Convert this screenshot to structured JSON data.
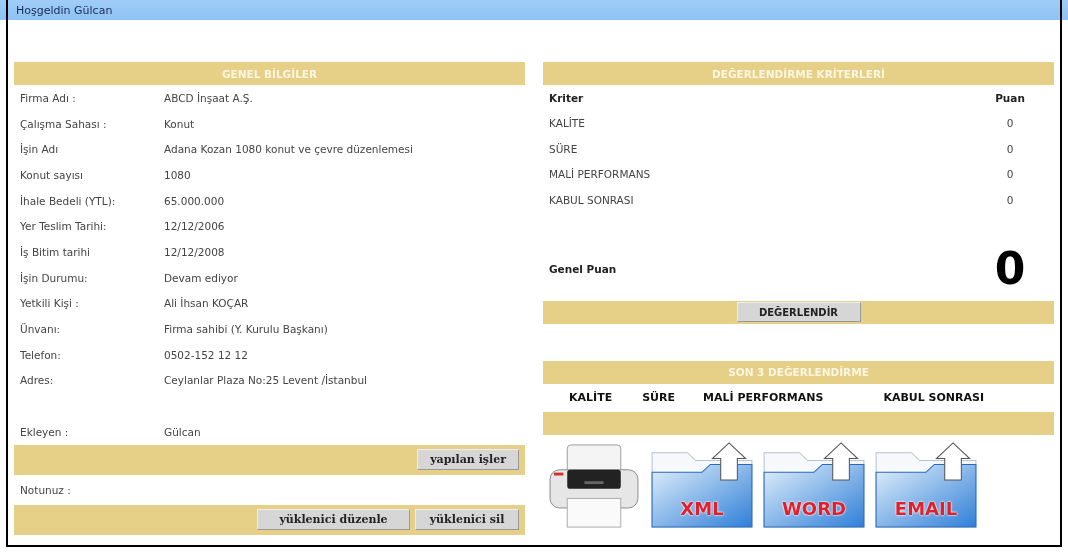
{
  "header": {
    "greeting": "Hoşgeldin Gülcan"
  },
  "general_info": {
    "title": "GENEL BİLGİLER",
    "rows": [
      {
        "label": "Firma Adı :",
        "value": "ABCD İnşaat A.Ş."
      },
      {
        "label": "Çalışma Sahası :",
        "value": "Konut"
      },
      {
        "label": "İşin Adı",
        "value": "Adana Kozan 1080 konut ve çevre düzenlemesi"
      },
      {
        "label": "Konut sayısı",
        "value": "1080"
      },
      {
        "label": "İhale Bedeli (YTL):",
        "value": "65.000.000"
      },
      {
        "label": "Yer Teslim Tarihi:",
        "value": "12/12/2006"
      },
      {
        "label": "İş Bitim tarihi",
        "value": "12/12/2008"
      },
      {
        "label": "İşin Durumu:",
        "value": "Devam ediyor"
      },
      {
        "label": "Yetkili Kişi :",
        "value": "Ali İhsan KOÇAR"
      },
      {
        "label": "Ünvanı:",
        "value": "Firma sahibi (Y. Kurulu Başkanı)"
      },
      {
        "label": "Telefon:",
        "value": "0502-152 12 12"
      },
      {
        "label": "Adres:",
        "value": "Ceylanlar Plaza No:25 Levent /İstanbul"
      }
    ],
    "added_by": {
      "label": "Ekleyen :",
      "value": "Gülcan"
    },
    "works_button": "yapılan işler",
    "note_label": "Notunuz :",
    "buttons": [
      "yüklenici düzenle",
      "yüklenici sil"
    ]
  },
  "criteria": {
    "title": "DEĞERLENDİRME KRİTERLERİ",
    "columns": [
      "Kriter",
      "Puan"
    ],
    "rows": [
      {
        "name": "KALİTE",
        "score": "0"
      },
      {
        "name": "SÜRE",
        "score": "0"
      },
      {
        "name": "MALİ PERFORMANS",
        "score": "0"
      },
      {
        "name": "KABUL SONRASI",
        "score": "0"
      }
    ],
    "total_label": "Genel Puan",
    "total": "0",
    "button": "DEĞERLENDİR"
  },
  "last_evaluations": {
    "title": "SON 3 DEĞERLENDİRME",
    "columns": [
      "KALİTE",
      "SÜRE",
      "MALİ PERFORMANS",
      "KABUL SONRASI"
    ]
  },
  "exports": [
    {
      "kind": "printer"
    },
    {
      "kind": "folder",
      "label": "XML"
    },
    {
      "kind": "folder",
      "label": "WORD"
    },
    {
      "kind": "folder",
      "label": "EMAIL"
    }
  ]
}
